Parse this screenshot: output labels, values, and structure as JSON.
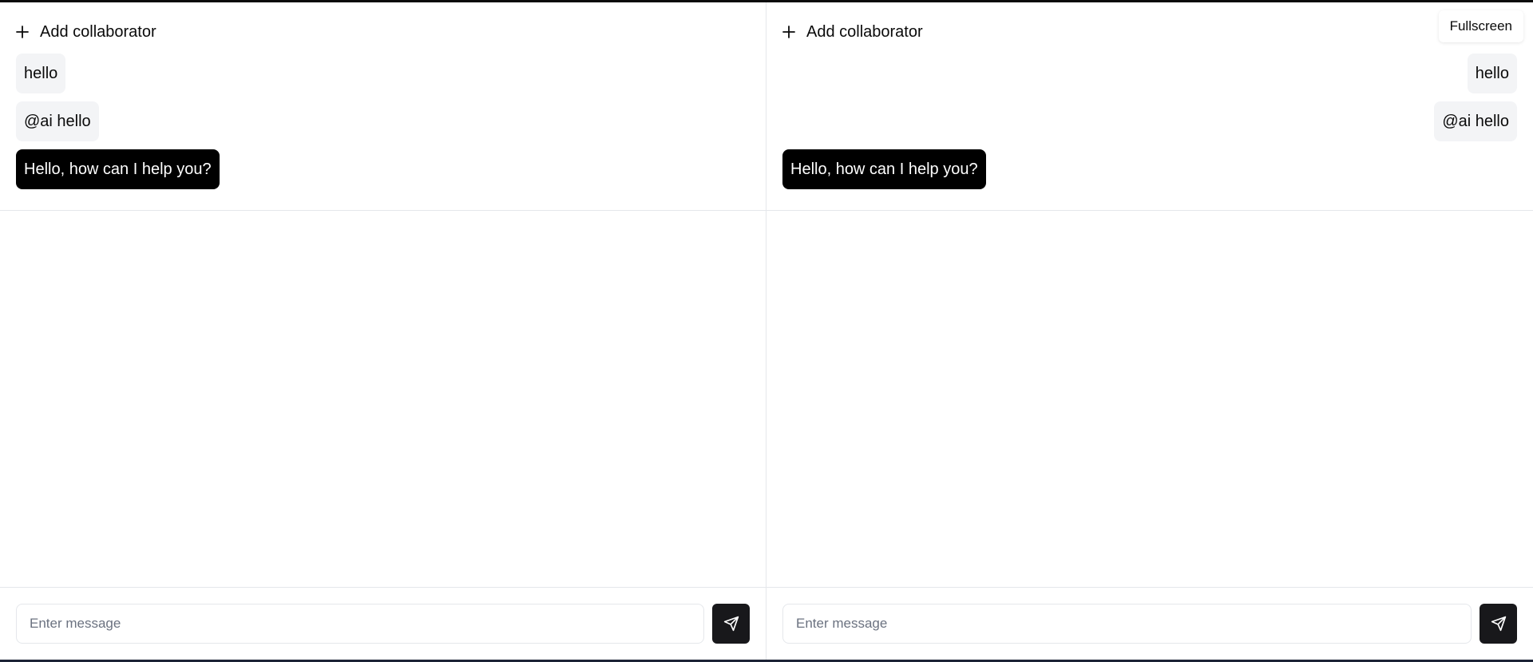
{
  "panes": [
    {
      "add_collaborator_label": "Add collaborator",
      "messages": [
        {
          "role": "user",
          "text": "hello"
        },
        {
          "role": "user",
          "text": "@ai hello"
        },
        {
          "role": "ai",
          "text": "Hello, how can I help you?"
        }
      ],
      "input": {
        "value": "",
        "placeholder": "Enter message"
      }
    },
    {
      "add_collaborator_label": "Add collaborator",
      "messages": [
        {
          "role": "user",
          "text": "hello"
        },
        {
          "role": "user",
          "text": "@ai hello"
        },
        {
          "role": "ai",
          "text": "Hello, how can I help you?"
        }
      ],
      "input": {
        "value": "",
        "placeholder": "Enter message"
      }
    }
  ],
  "fullscreen_label": "Fullscreen",
  "icons": {
    "add": "plus-icon",
    "send": "send-icon"
  },
  "colors": {
    "ai_bubble": "#000000",
    "user_bubble": "#f3f4f6",
    "send_button": "#18181b"
  }
}
